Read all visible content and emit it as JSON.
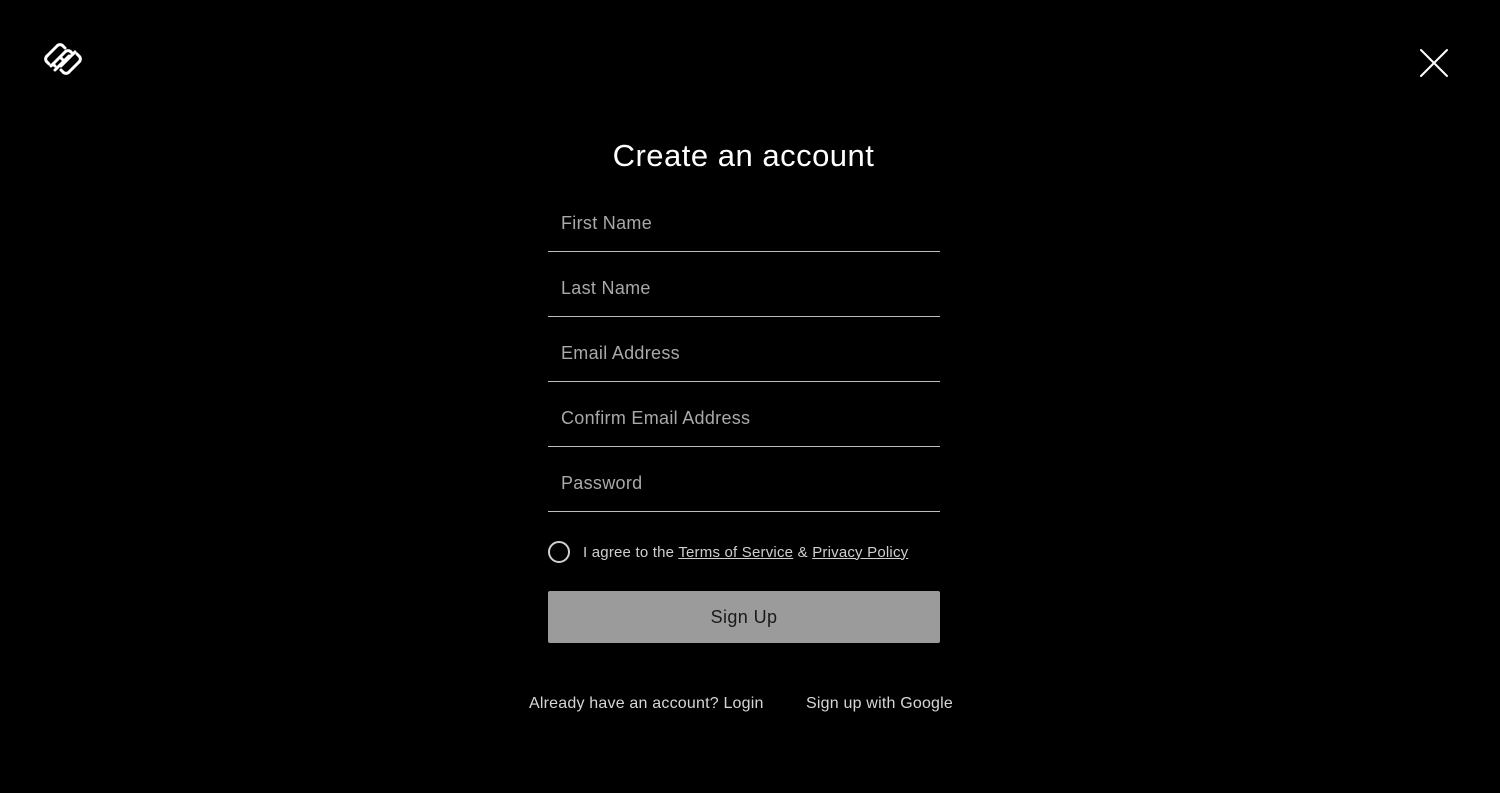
{
  "header": {
    "logo_icon": "squarespace-logo-icon",
    "close_icon": "close-icon"
  },
  "form": {
    "title": "Create an account",
    "fields": [
      {
        "placeholder": "First Name",
        "value": ""
      },
      {
        "placeholder": "Last Name",
        "value": ""
      },
      {
        "placeholder": "Email Address",
        "value": ""
      },
      {
        "placeholder": "Confirm Email Address",
        "value": ""
      },
      {
        "placeholder": "Password",
        "value": ""
      }
    ],
    "agree": {
      "prefix": "I agree to the",
      "terms_label": "Terms of Service",
      "connector": "&",
      "privacy_label": "Privacy Policy",
      "checked": false
    },
    "submit_label": "Sign Up"
  },
  "footer": {
    "login_label": "Already have an account? Login",
    "google_label": "Sign up with Google"
  },
  "colors": {
    "background": "#000000",
    "text": "#ffffff",
    "placeholder": "#a9a9a9",
    "button_bg": "#9b9b9b",
    "button_text": "#1a1a1a"
  }
}
